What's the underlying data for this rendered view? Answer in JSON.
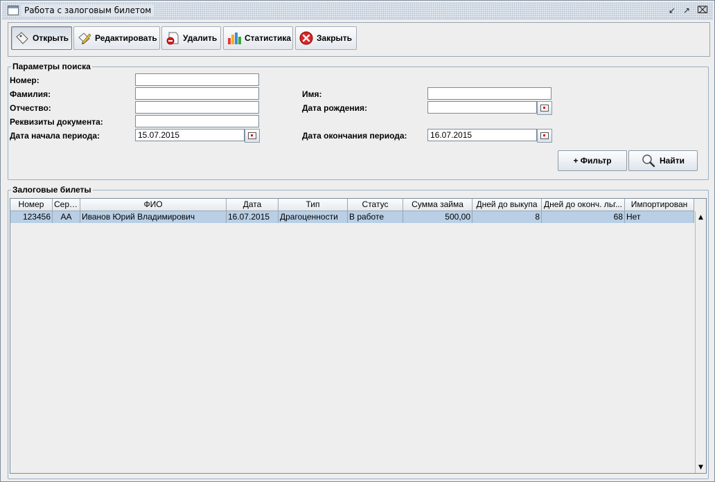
{
  "window": {
    "title": "Работа с залоговым билетом"
  },
  "toolbar": {
    "open": "Открыть",
    "edit": "Редактировать",
    "delete": "Удалить",
    "stats": "Статистика",
    "close": "Закрыть"
  },
  "search": {
    "legend": "Параметры поиска",
    "number_label": "Номер:",
    "number": "",
    "lastname_label": "Фамилия:",
    "lastname": "",
    "firstname_label": "Имя:",
    "firstname": "",
    "patronymic_label": "Отчество:",
    "patronymic": "",
    "birthdate_label": "Дата рождения:",
    "birthdate": "",
    "document_label": "Реквизиты документа:",
    "document": "",
    "period_start_label": "Дата начала периода:",
    "period_start": "15.07.2015",
    "period_end_label": "Дата окончания периода:",
    "period_end": "16.07.2015",
    "filter_button": "+ Фильтр",
    "find_button": "Найти"
  },
  "tickets": {
    "legend": "Залоговые билеты",
    "columns": [
      "Номер",
      "Серия",
      "ФИО",
      "Дата",
      "Тип",
      "Статус",
      "Сумма займа",
      "Дней до выкупа",
      "Дней до оконч. льг...",
      "Импортирован"
    ],
    "rows": [
      [
        "123456",
        "АА",
        "Иванов Юрий Владимирович",
        "16.07.2015",
        "Драгоценности",
        "В работе",
        "500,00",
        "8",
        "68",
        "Нет"
      ]
    ]
  },
  "colors": {
    "selection": "#b8cfe5",
    "border": "#7a8a99"
  }
}
